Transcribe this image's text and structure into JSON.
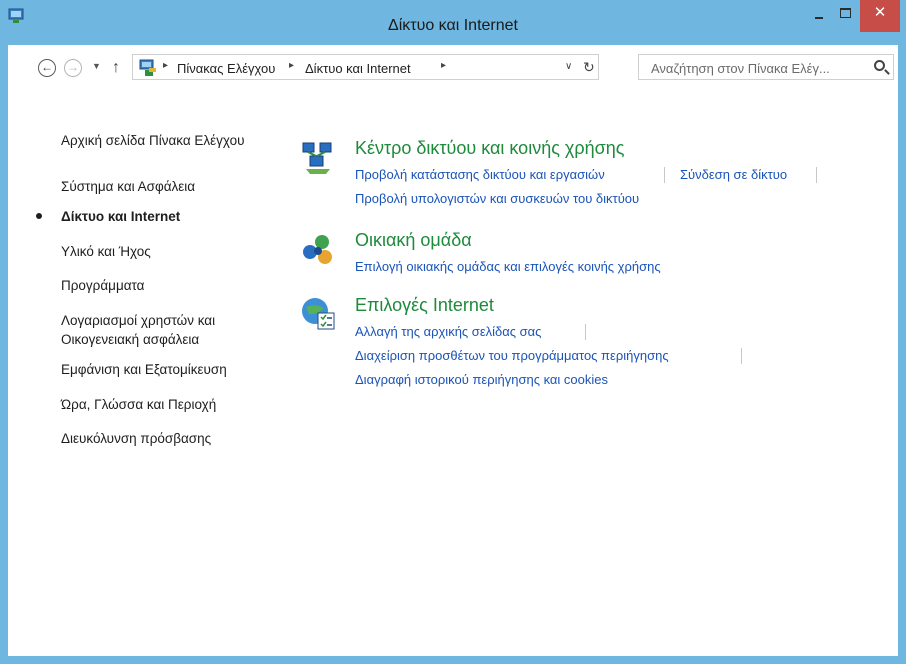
{
  "window": {
    "title": "Δίκτυο και Internet",
    "close_glyph": "✕"
  },
  "toolbar": {
    "back_glyph": "←",
    "forward_glyph": "→",
    "recent_glyph": "▼",
    "up_glyph": "↑",
    "breadcrumbs": [
      "Πίνακας Ελέγχου",
      "Δίκτυο και Internet"
    ],
    "refresh_glyph": "↻",
    "search_placeholder": "Αναζήτηση στον Πίνακα Ελέγ..."
  },
  "sidebar": {
    "items": [
      {
        "label": "Αρχική σελίδα Πίνακα Ελέγχου"
      },
      {
        "label": "Σύστημα και Ασφάλεια"
      },
      {
        "label": "Δίκτυο και Internet",
        "active": true
      },
      {
        "label": "Υλικό και Ήχος"
      },
      {
        "label": "Προγράμματα"
      },
      {
        "label": "Λογαριασμοί χρηστών και Οικογενειακή ασφάλεια"
      },
      {
        "label": "Εμφάνιση και Εξατομίκευση"
      },
      {
        "label": "Ώρα, Γλώσσα και Περιοχή"
      },
      {
        "label": "Διευκόλυνση πρόσβασης"
      }
    ]
  },
  "categories": [
    {
      "title": "Κέντρο δικτύου και κοινής χρήσης",
      "icon": "network-center-icon",
      "links": [
        "Προβολή κατάστασης δικτύου και εργασιών",
        "Σύνδεση σε δίκτυο",
        "Προβολή υπολογιστών και συσκευών του δικτύου"
      ]
    },
    {
      "title": "Οικιακή ομάδα",
      "icon": "homegroup-icon",
      "links": [
        "Επιλογή οικιακής ομάδας και επιλογές κοινής χρήσης"
      ]
    },
    {
      "title": "Επιλογές Internet",
      "icon": "internet-options-icon",
      "links": [
        "Αλλαγή της αρχικής σελίδας σας",
        "Διαχείριση προσθέτων του προγράμματος περιήγησης",
        "Διαγραφή ιστορικού περιήγησης και cookies"
      ]
    }
  ],
  "colors": {
    "frame": "#6fb6e0",
    "close": "#c74d48",
    "category_title": "#1e8a3c",
    "link": "#1a54b8"
  }
}
